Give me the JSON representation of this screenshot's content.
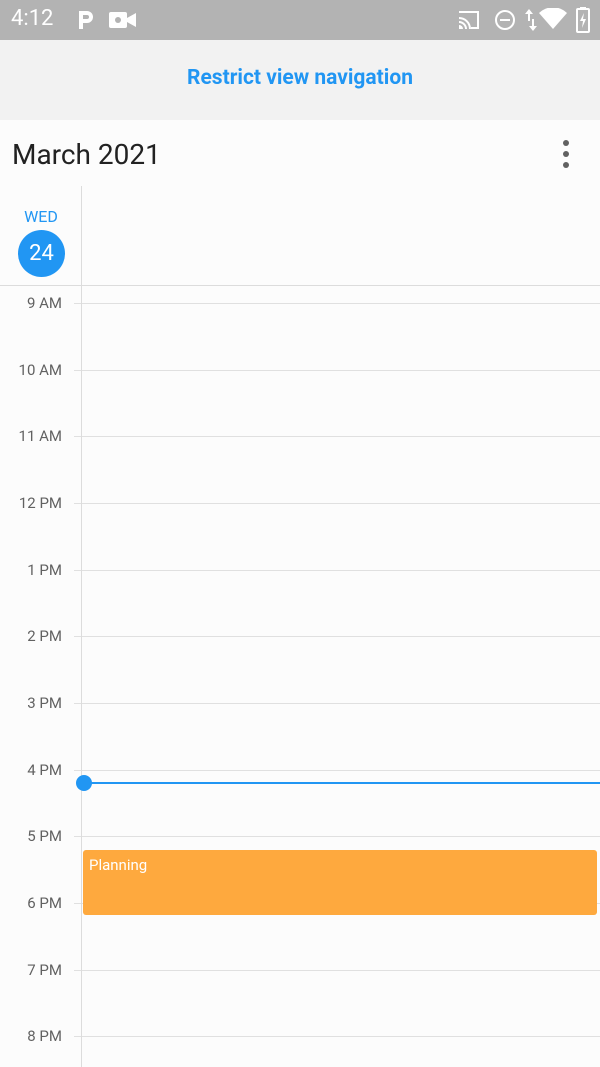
{
  "status_bar": {
    "time": "4:12",
    "left_icons": [
      "parking-p-icon",
      "video-camera-icon"
    ],
    "right_icons": [
      "cast-icon",
      "do-not-disturb-icon",
      "data-arrows-icon",
      "wifi-icon",
      "battery-charging-icon"
    ]
  },
  "app_bar": {
    "title": "Restrict view navigation"
  },
  "calendar": {
    "month_title": "March 2021",
    "more_icon": "more-vertical-icon",
    "day": {
      "name": "WED",
      "number": "24"
    },
    "hours": [
      "9 AM",
      "10 AM",
      "11 AM",
      "12 PM",
      "1 PM",
      "2 PM",
      "3 PM",
      "4 PM",
      "5 PM",
      "6 PM",
      "7 PM",
      "8 PM"
    ],
    "appointment": {
      "subject": "Planning",
      "color": "#fea93e"
    },
    "accent_color": "#2196f3"
  }
}
